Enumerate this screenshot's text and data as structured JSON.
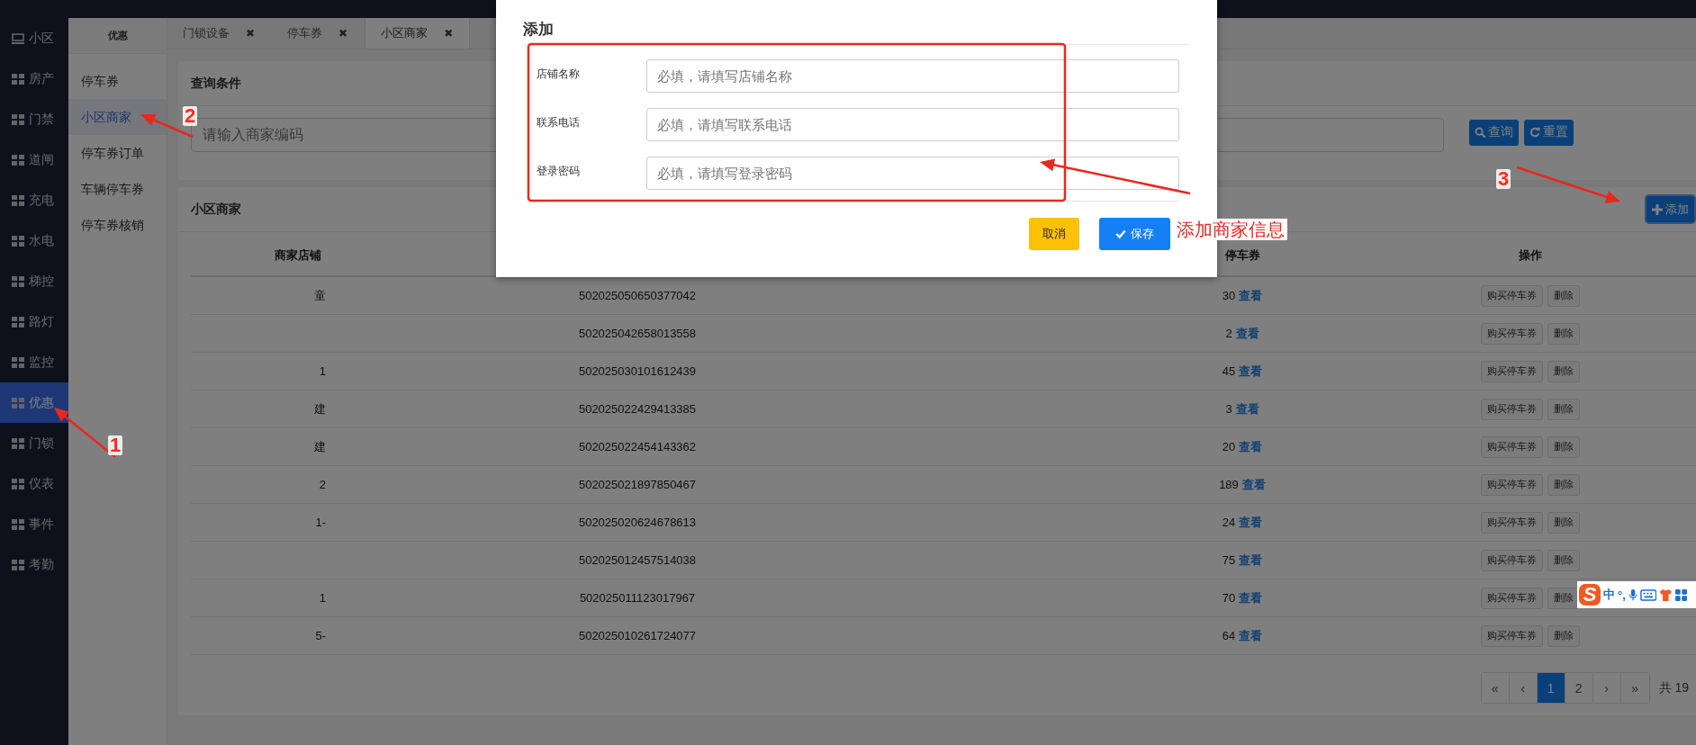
{
  "sidebar": {
    "items": [
      {
        "label": "小区",
        "selected": false
      },
      {
        "label": "房产",
        "selected": false
      },
      {
        "label": "门禁",
        "selected": false
      },
      {
        "label": "道闸",
        "selected": false
      },
      {
        "label": "充电",
        "selected": false
      },
      {
        "label": "水电",
        "selected": false
      },
      {
        "label": "梯控",
        "selected": false
      },
      {
        "label": "路灯",
        "selected": false
      },
      {
        "label": "监控",
        "selected": false
      },
      {
        "label": "优惠",
        "selected": true
      },
      {
        "label": "门锁",
        "selected": false
      },
      {
        "label": "仪表",
        "selected": false
      },
      {
        "label": "事件",
        "selected": false
      },
      {
        "label": "考勤",
        "selected": false
      }
    ]
  },
  "subnav": {
    "title": "优惠",
    "items": [
      {
        "label": "停车券",
        "selected": false
      },
      {
        "label": "小区商家",
        "selected": true
      },
      {
        "label": "停车券订单",
        "selected": false
      },
      {
        "label": "车辆停车券",
        "selected": false
      },
      {
        "label": "停车券核销",
        "selected": false
      }
    ]
  },
  "tabs": [
    {
      "label": "门锁设备",
      "close": "✖",
      "selected": false
    },
    {
      "label": "停车券",
      "close": "✖",
      "selected": false
    },
    {
      "label": "小区商家",
      "close": "✖",
      "selected": true
    }
  ],
  "query": {
    "title": "查询条件",
    "placeholder": "请输入商家编码",
    "buttons": [
      {
        "label": "查询",
        "kind": "search"
      },
      {
        "label": "重置",
        "kind": "refresh"
      }
    ]
  },
  "list": {
    "title": "小区商家",
    "add_button": "添加",
    "columns": [
      "商家店铺",
      "停车券",
      "操作"
    ],
    "rows": [
      {
        "store": "童",
        "code": "502025050650377042",
        "coupons": "30",
        "view": "查看",
        "actions": [
          "购买停车券",
          "删除"
        ]
      },
      {
        "code": "502025042658013558",
        "coupons": "2",
        "view": "查看",
        "actions": [
          "购买停车券",
          "删除"
        ]
      },
      {
        "store": "1",
        "code": "502025030101612439",
        "coupons": "45",
        "view": "查看",
        "actions": [
          "购买停车券",
          "删除"
        ]
      },
      {
        "store": "建",
        "code": "502025022429413385",
        "coupons": "3",
        "view": "查看",
        "actions": [
          "购买停车券",
          "删除"
        ]
      },
      {
        "store": "建",
        "code": "502025022454143362",
        "coupons": "20",
        "view": "查看",
        "actions": [
          "购买停车券",
          "删除"
        ]
      },
      {
        "store": "2",
        "code": "502025021897850467",
        "coupons": "189",
        "view": "查看",
        "actions": [
          "购买停车券",
          "删除"
        ]
      },
      {
        "store": "1-",
        "code": "502025020624678613",
        "coupons": "24",
        "view": "查看",
        "actions": [
          "购买停车券",
          "删除"
        ]
      },
      {
        "code": "502025012457514038",
        "coupons": "75",
        "view": "查看",
        "actions": [
          "购买停车券",
          "删除"
        ]
      },
      {
        "store": "1",
        "code": "502025011123017967",
        "coupons": "70",
        "view": "查看",
        "actions": [
          "购买停车券",
          "删除"
        ]
      },
      {
        "store": "5-",
        "code": "502025010261724077",
        "coupons": "64",
        "view": "查看",
        "actions": [
          "购买停车券",
          "删除"
        ]
      }
    ],
    "pagination": {
      "pages": [
        {
          "label": "«",
          "selected": false
        },
        {
          "label": "‹",
          "selected": false
        },
        {
          "label": "1",
          "selected": true
        },
        {
          "label": "2",
          "selected": false
        },
        {
          "label": "›",
          "selected": false
        },
        {
          "label": "»",
          "selected": false
        }
      ],
      "total": "共 19"
    }
  },
  "modal": {
    "title": "添加",
    "fields": [
      {
        "label": "店铺名称",
        "placeholder": "必填，请填写店铺名称"
      },
      {
        "label": "联系电话",
        "placeholder": "必填，请填写联系电话"
      },
      {
        "label": "登录密码",
        "placeholder": "必填，请填写登录密码"
      }
    ],
    "buttons": [
      {
        "label": "取消",
        "kind": "cancel"
      },
      {
        "label": "保存",
        "kind": "save"
      }
    ]
  },
  "annotations": {
    "numbers": [
      "1",
      "2",
      "3"
    ],
    "note": "添加商家信息"
  },
  "ime": {
    "logo": "S",
    "mode": "中",
    "punct": "°,"
  }
}
